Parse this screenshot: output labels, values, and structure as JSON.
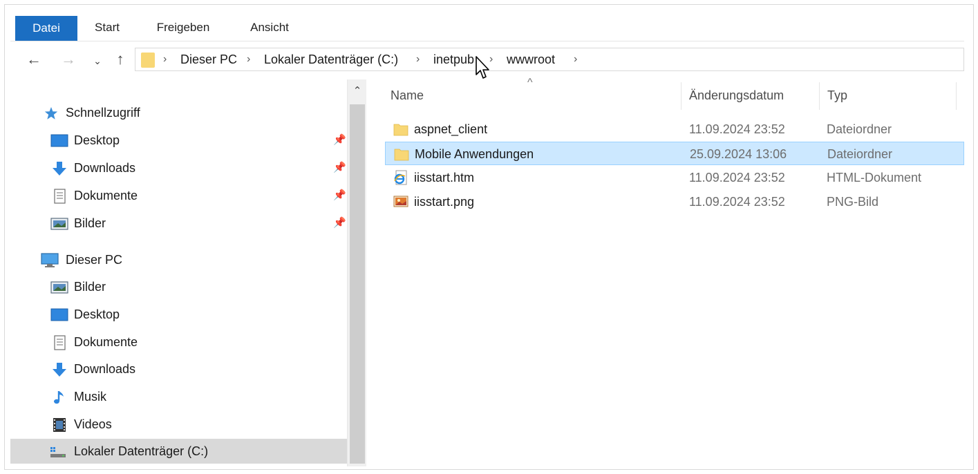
{
  "ribbon": {
    "tabs": [
      "Datei",
      "Start",
      "Freigeben",
      "Ansicht"
    ]
  },
  "navbar": {
    "back": "←",
    "forward": "→",
    "recent": "⌄",
    "up": "↑",
    "breadcrumb": [
      "Dieser PC",
      "Lokaler Datenträger (C:)",
      "inetpub",
      "wwwroot"
    ],
    "separator": "›"
  },
  "sidebar": {
    "quick_access": {
      "label": "Schnellzugriff",
      "items": [
        {
          "label": "Desktop",
          "icon": "desktop-icon",
          "pinned": true
        },
        {
          "label": "Downloads",
          "icon": "downloads-icon",
          "pinned": true
        },
        {
          "label": "Dokumente",
          "icon": "documents-icon",
          "pinned": true
        },
        {
          "label": "Bilder",
          "icon": "pictures-icon",
          "pinned": true
        }
      ]
    },
    "this_pc": {
      "label": "Dieser PC",
      "items": [
        {
          "label": "Bilder",
          "icon": "pictures-icon"
        },
        {
          "label": "Desktop",
          "icon": "desktop-icon"
        },
        {
          "label": "Dokumente",
          "icon": "documents-icon"
        },
        {
          "label": "Downloads",
          "icon": "downloads-icon"
        },
        {
          "label": "Musik",
          "icon": "music-icon"
        },
        {
          "label": "Videos",
          "icon": "videos-icon"
        },
        {
          "label": "Lokaler Datenträger (C:)",
          "icon": "drive-icon",
          "selected": true
        }
      ]
    },
    "scroll_up": "⌃"
  },
  "filelist": {
    "columns": {
      "name": "Name",
      "date": "Änderungsdatum",
      "type": "Typ"
    },
    "sort_indicator": "^",
    "rows": [
      {
        "name": "aspnet_client",
        "date": "11.09.2024 23:52",
        "type": "Dateiordner",
        "icon": "folder-icon"
      },
      {
        "name": "Mobile Anwendungen",
        "date": "25.09.2024 13:06",
        "type": "Dateiordner",
        "icon": "folder-icon",
        "selected": true
      },
      {
        "name": "iisstart.htm",
        "date": "11.09.2024 23:52",
        "type": "HTML-Dokument",
        "icon": "html-file-icon"
      },
      {
        "name": "iisstart.png",
        "date": "11.09.2024 23:52",
        "type": "PNG-Bild",
        "icon": "png-file-icon"
      }
    ]
  },
  "colors": {
    "accent": "#1b6ec2",
    "selection": "#cce8ff",
    "selection_border": "#99d1ff",
    "folder": "#f8d775",
    "nav_selected": "#d9d9d9"
  }
}
